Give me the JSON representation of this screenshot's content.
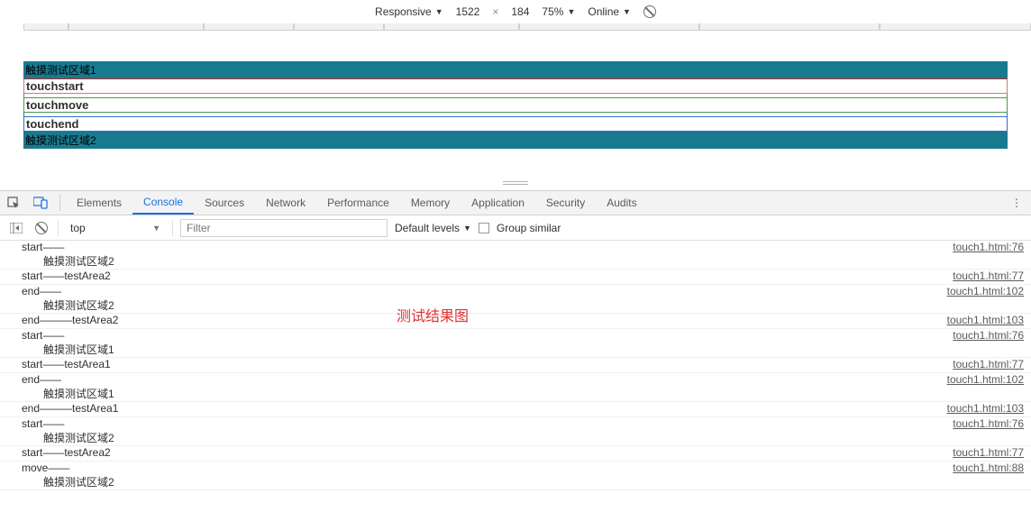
{
  "device_bar": {
    "mode": "Responsive",
    "width": "1522",
    "height": "184",
    "zoom": "75%",
    "throttle": "Online"
  },
  "viewport": {
    "teal1": "触摸测试区域1",
    "row1": "touchstart",
    "row2": "touchmove",
    "row3": "touchend",
    "teal2": "触摸测试区域2"
  },
  "tabs": [
    "Elements",
    "Console",
    "Sources",
    "Network",
    "Performance",
    "Memory",
    "Application",
    "Security",
    "Audits"
  ],
  "active_tab": "Console",
  "filter": {
    "scope": "top",
    "placeholder": "Filter",
    "levels": "Default levels",
    "group": "Group similar"
  },
  "annotation": "测试结果图",
  "logs": [
    {
      "l1": "start——",
      "l2": "触摸测试区域2",
      "src": "touch1.html:76"
    },
    {
      "l1": "start——testArea2",
      "src": "touch1.html:77"
    },
    {
      "l1": "end——",
      "l2": "触摸测试区域2",
      "src": "touch1.html:102"
    },
    {
      "l1": "end———testArea2",
      "src": "touch1.html:103"
    },
    {
      "l1": "start——",
      "l2": "触摸测试区域1",
      "src": "touch1.html:76"
    },
    {
      "l1": "start——testArea1",
      "src": "touch1.html:77"
    },
    {
      "l1": "end——",
      "l2": "触摸测试区域1",
      "src": "touch1.html:102"
    },
    {
      "l1": "end———testArea1",
      "src": "touch1.html:103"
    },
    {
      "l1": "start——",
      "l2": "触摸测试区域2",
      "src": "touch1.html:76"
    },
    {
      "l1": "start——testArea2",
      "src": "touch1.html:77"
    },
    {
      "l1": "move——",
      "l2": "触摸测试区域2",
      "src": "touch1.html:88"
    }
  ]
}
